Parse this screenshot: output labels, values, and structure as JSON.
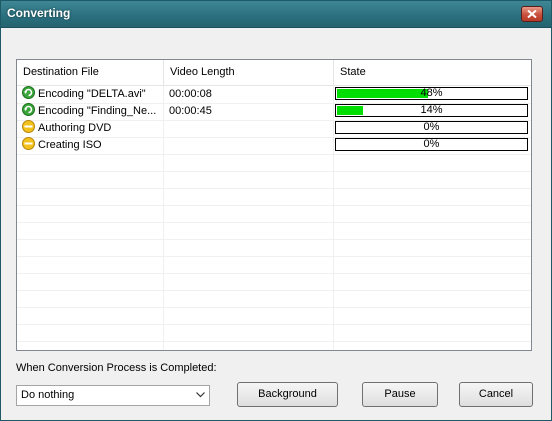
{
  "window": {
    "title": "Converting"
  },
  "list": {
    "columns": [
      "Destination File",
      "Video Length",
      "State"
    ],
    "rows": [
      {
        "icon": "refresh-green-icon",
        "file": "Encoding \"DELTA.avi\"",
        "length": "00:00:08",
        "progress": 48,
        "progress_text": "48%"
      },
      {
        "icon": "refresh-green-icon",
        "file": "Encoding \"Finding_Ne...",
        "length": "00:00:45",
        "progress": 14,
        "progress_text": "14%"
      },
      {
        "icon": "pending-yellow-icon",
        "file": "Authoring DVD",
        "length": "",
        "progress": 0,
        "progress_text": "0%"
      },
      {
        "icon": "pending-yellow-icon",
        "file": "Creating ISO",
        "length": "",
        "progress": 0,
        "progress_text": "0%"
      }
    ]
  },
  "completion": {
    "label": "When Conversion Process is Completed:",
    "selected": "Do nothing"
  },
  "buttons": {
    "background": "Background",
    "pause": "Pause",
    "cancel": "Cancel"
  },
  "colors": {
    "titlebar": "#2a6f7e",
    "progress_fill": "#00dd00",
    "close_button": "#c8503c"
  }
}
